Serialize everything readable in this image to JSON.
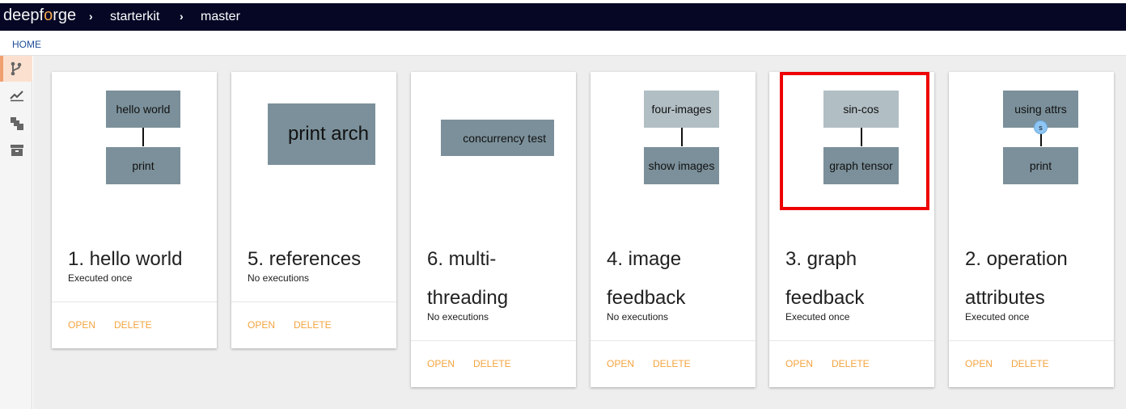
{
  "brand": {
    "logo_main": "deepf",
    "logo_accent": "o",
    "logo_end": "rge"
  },
  "navbar": {
    "crumbs": [
      "starterkit",
      "master"
    ],
    "separator": "›"
  },
  "breadcrumb": {
    "home": "HOME"
  },
  "sidebar": {
    "icons": [
      "branch-icon",
      "line-chart-icon",
      "layers-icon",
      "archive-icon"
    ],
    "active_index": 0
  },
  "colors": {
    "navbar": "#050725",
    "accent": "#f4a440",
    "operation": "#7b909a",
    "operation_light": "#b1bec4",
    "highlight": "#ee0000"
  },
  "actions": {
    "open": "OPEN",
    "delete": "DELETE"
  },
  "cards": [
    {
      "title": "1. hello world",
      "status": "Executed once",
      "ops": [
        "hello world",
        "print"
      ]
    },
    {
      "title": "5. references",
      "status": "No executions",
      "ops": [
        "print arch"
      ]
    },
    {
      "title": "6. multi-threading",
      "status": "No executions",
      "ops": [
        "concurrency test"
      ]
    },
    {
      "title": "4. image feedback",
      "status": "No executions",
      "ops": [
        "four-images",
        "show images"
      ]
    },
    {
      "title": "3. graph feedback",
      "status": "Executed once",
      "ops": [
        "sin-cos",
        "graph tensor"
      ]
    },
    {
      "title": "2. operation attributes",
      "status": "Executed once",
      "ops": [
        "using attrs",
        "print"
      ],
      "attr_badge": "s"
    }
  ]
}
